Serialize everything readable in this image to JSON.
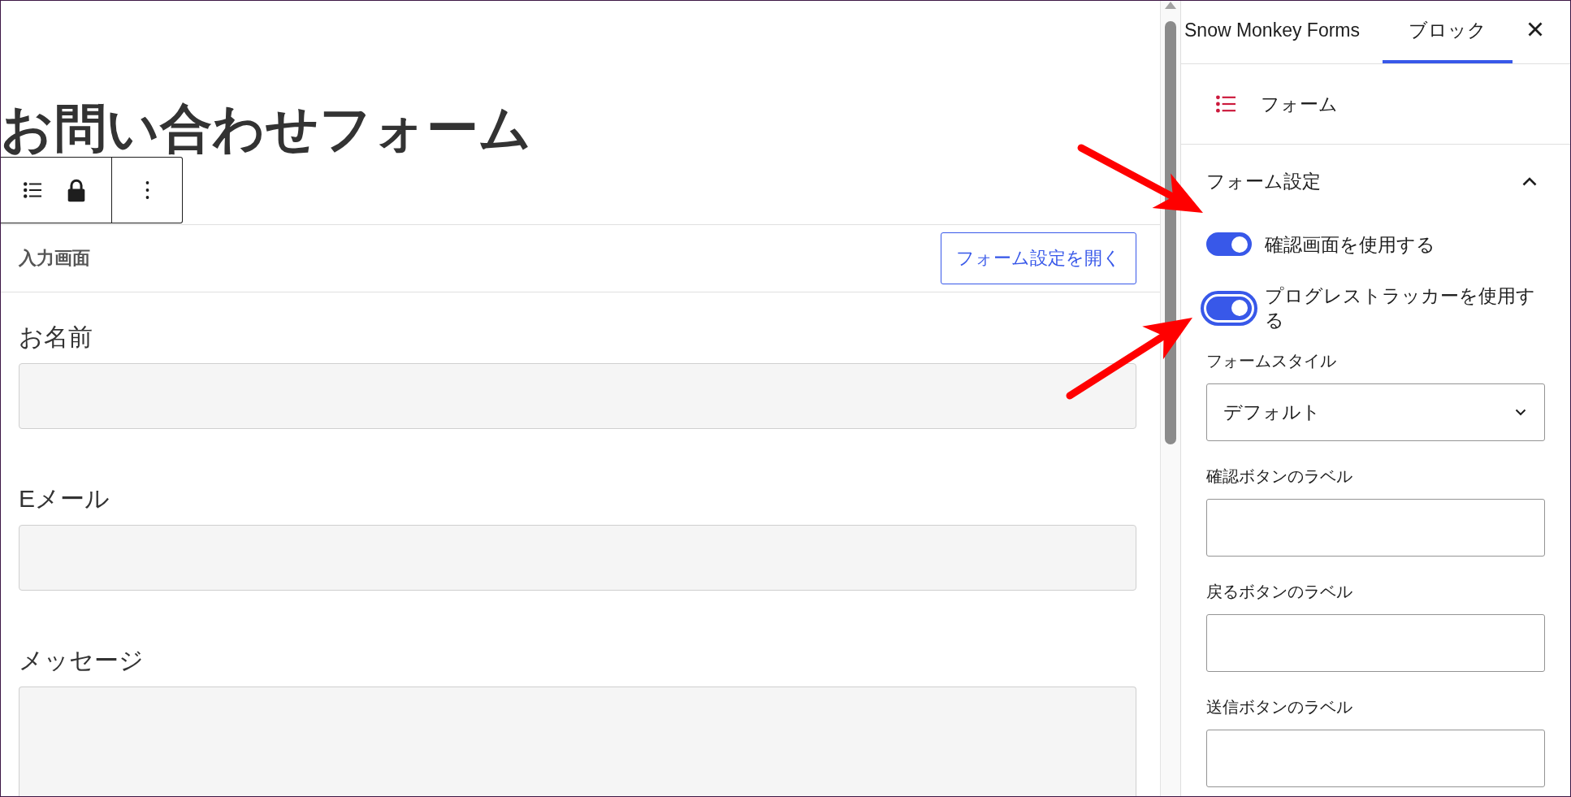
{
  "editor": {
    "title": "お問い合わせフォーム"
  },
  "form_block": {
    "screen_label": "入力画面",
    "open_settings_button": "フォーム設定を開く",
    "fields": [
      {
        "label": "お名前",
        "kind": "text"
      },
      {
        "label": "Eメール",
        "kind": "text"
      },
      {
        "label": "メッセージ",
        "kind": "textarea"
      }
    ]
  },
  "sidebar": {
    "tabs": [
      {
        "label": "Snow Monkey Forms",
        "selected": false
      },
      {
        "label": "ブロック",
        "selected": true
      }
    ],
    "block_card": {
      "title": "フォーム"
    },
    "panel": {
      "title": "フォーム設定",
      "expanded": true,
      "toggles": [
        {
          "label": "確認画面を使用する",
          "checked": true,
          "focused": false,
          "annotated": true
        },
        {
          "label": "プログレストラッカーを使用する",
          "checked": true,
          "focused": true,
          "annotated": true
        }
      ],
      "style_select": {
        "label": "フォームスタイル",
        "value": "デフォルト"
      },
      "text_fields": [
        {
          "label": "確認ボタンのラベル"
        },
        {
          "label": "戻るボタンのラベル"
        },
        {
          "label": "送信ボタンのラベル"
        }
      ]
    }
  }
}
